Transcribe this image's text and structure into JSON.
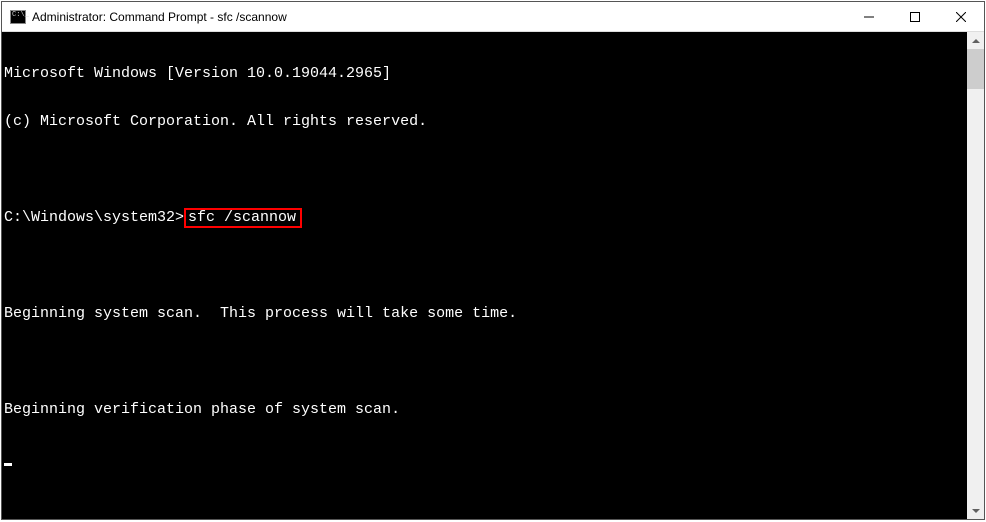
{
  "window": {
    "title": "Administrator: Command Prompt - sfc  /scannow"
  },
  "terminal": {
    "line1": "Microsoft Windows [Version 10.0.19044.2965]",
    "line2": "(c) Microsoft Corporation. All rights reserved.",
    "blank1": "",
    "prompt": "C:\\Windows\\system32>",
    "command": "sfc /scannow",
    "blank2": "",
    "line4": "Beginning system scan.  This process will take some time.",
    "blank3": "",
    "line5": "Beginning verification phase of system scan."
  }
}
